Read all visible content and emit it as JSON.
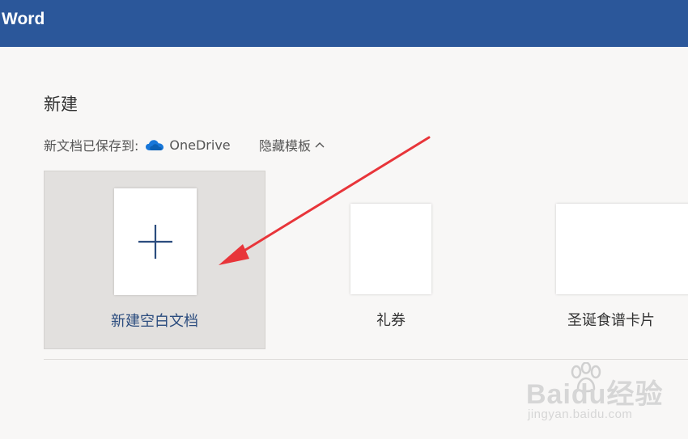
{
  "app": {
    "title": "Word",
    "brand_color": "#2b579a"
  },
  "new_section": {
    "title": "新建",
    "save_prefix": "新文档已保存到:",
    "save_location": "OneDrive",
    "save_location_icon": "onedrive-cloud-icon",
    "toggle_label": "隐藏模板",
    "toggle_icon": "chevron-up-icon"
  },
  "templates": [
    {
      "label": "新建空白文档",
      "icon": "plus-icon",
      "selected": true
    },
    {
      "label": "礼券",
      "selected": false
    },
    {
      "label": "圣诞食谱卡片",
      "selected": false
    }
  ],
  "annotation": {
    "arrow_color": "#e8353a"
  },
  "watermark": {
    "brand": "Baidu经验",
    "url": "jingyan.baidu.com"
  }
}
